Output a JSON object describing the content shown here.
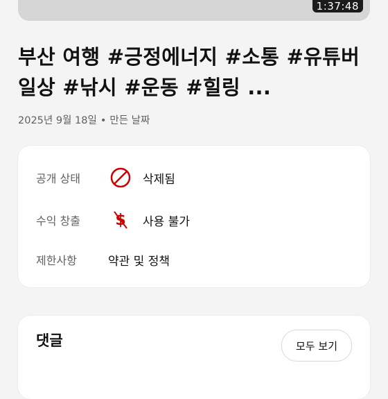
{
  "video": {
    "duration": "1:37:48"
  },
  "title": "부산 여행 #긍정에너지 #소통 #유튜버일상 #낚시 #운동 #힐링 ...",
  "meta": {
    "date": "2025년 9월 18일",
    "separator": "•",
    "date_label": "만든 날짜"
  },
  "status_card": {
    "rows": [
      {
        "label": "공개 상태",
        "icon": "prohibited-icon",
        "value": "삭제됨"
      },
      {
        "label": "수익 창출",
        "icon": "monetization-off-icon",
        "value": "사용 불가"
      },
      {
        "label": "제한사항",
        "value": "약관 및 정책"
      }
    ]
  },
  "comments": {
    "title": "댓글",
    "view_all_label": "모두 보기"
  },
  "colors": {
    "accent_red": "#cc0000",
    "secondary_text": "#606060"
  }
}
